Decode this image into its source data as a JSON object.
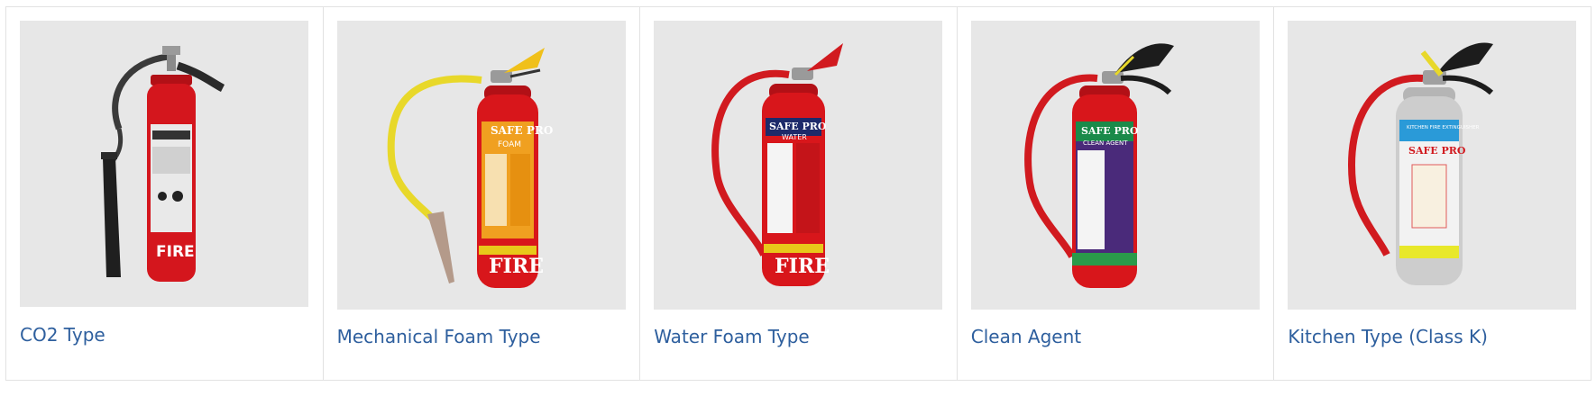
{
  "products": [
    {
      "title": "CO2 Type",
      "image": {
        "kind": "co2",
        "label_band": "FIRE",
        "body_color": "#d4161d"
      }
    },
    {
      "title": "Mechanical Foam Type",
      "image": {
        "kind": "foam",
        "brand": "SAFE PRO",
        "agent": "FOAM",
        "label_band": "FIRE",
        "body_color": "#d8161b",
        "label_color": "#f0a020",
        "hose_color": "#e8d82a"
      }
    },
    {
      "title": "Water Foam Type",
      "image": {
        "kind": "water",
        "brand": "SAFE PRO",
        "agent": "WATER",
        "label_band": "FIRE",
        "body_color": "#d8161b",
        "label_color": "#e01d22",
        "hose_color": "#d11a1f"
      }
    },
    {
      "title": "Clean Agent",
      "image": {
        "kind": "clean",
        "brand": "SAFE PRO",
        "agent": "CLEAN AGENT",
        "body_color": "#d8161b",
        "label_color": "#4a2a7a",
        "hose_color": "#d11a1f"
      }
    },
    {
      "title": "Kitchen Type (Class K)",
      "image": {
        "kind": "kitchen",
        "brand": "SAFE PRO",
        "agent": "KITCHEN FIRE EXTINGUISHER",
        "body_color": "#c9c9c9",
        "label_color": "#f2f2f2",
        "hose_color": "#d11a1f"
      }
    }
  ]
}
